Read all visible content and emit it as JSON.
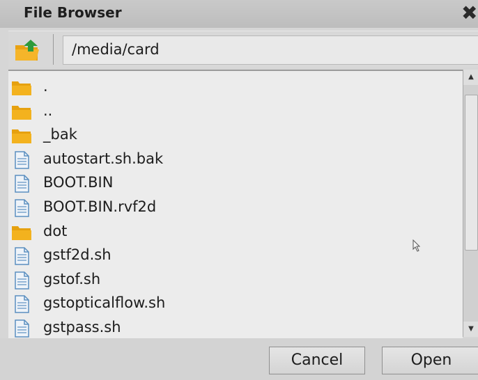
{
  "window": {
    "title": "File Browser",
    "close_glyph": "✖"
  },
  "pathbar": {
    "up_icon": "folder-up-icon",
    "path": "/media/card"
  },
  "files": [
    {
      "name": ".",
      "type": "folder"
    },
    {
      "name": "..",
      "type": "folder"
    },
    {
      "name": "_bak",
      "type": "folder"
    },
    {
      "name": "autostart.sh.bak",
      "type": "file"
    },
    {
      "name": "BOOT.BIN",
      "type": "file"
    },
    {
      "name": "BOOT.BIN.rvf2d",
      "type": "file"
    },
    {
      "name": "dot",
      "type": "folder"
    },
    {
      "name": "gstf2d.sh",
      "type": "file"
    },
    {
      "name": "gstof.sh",
      "type": "file"
    },
    {
      "name": "gstopticalflow.sh",
      "type": "file"
    },
    {
      "name": "gstpass.sh",
      "type": "file"
    }
  ],
  "scrollbar": {
    "up_glyph": "▲",
    "down_glyph": "▼"
  },
  "buttons": {
    "cancel": "Cancel",
    "open": "Open"
  },
  "colors": {
    "folder": "#f3b21e",
    "file_icon": "#5b8fc0",
    "up_arrow": "#2e9a3a"
  }
}
